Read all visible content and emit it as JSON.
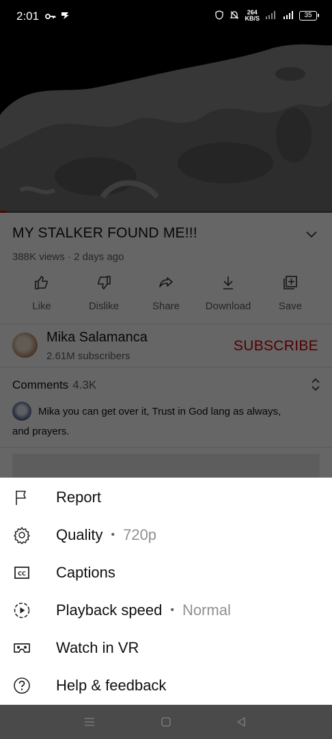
{
  "status_bar": {
    "time": "2:01",
    "speed_value": "264",
    "speed_unit": "KB/S",
    "battery": "35"
  },
  "video": {
    "title": "MY STALKER FOUND ME!!!",
    "views": "388K views",
    "age": "2 days ago",
    "progress": 0.02
  },
  "actions": [
    {
      "label": "Like",
      "icon": "thumbs-up-icon"
    },
    {
      "label": "Dislike",
      "icon": "thumbs-down-icon"
    },
    {
      "label": "Share",
      "icon": "share-icon"
    },
    {
      "label": "Download",
      "icon": "download-icon"
    },
    {
      "label": "Save",
      "icon": "save-to-playlist-icon"
    }
  ],
  "channel": {
    "name": "Mika Salamanca",
    "subscribers": "2.61M subscribers",
    "subscribe_label": "SUBSCRIBE"
  },
  "comments": {
    "label": "Comments",
    "count": "4.3K",
    "top_comment_line1": "Mika you can get over it, Trust in God lang as always,",
    "top_comment_line2": "and prayers."
  },
  "menu": {
    "report": "Report",
    "quality": "Quality",
    "quality_value": "720p",
    "captions": "Captions",
    "playback_speed": "Playback speed",
    "playback_speed_value": "Normal",
    "watch_vr": "Watch in VR",
    "help": "Help & feedback",
    "separator": "•"
  },
  "colors": {
    "subscribe_red": "#cc0000",
    "sheet_bg": "#ffffff",
    "nav_bar_bg": "#4a4a4a"
  }
}
